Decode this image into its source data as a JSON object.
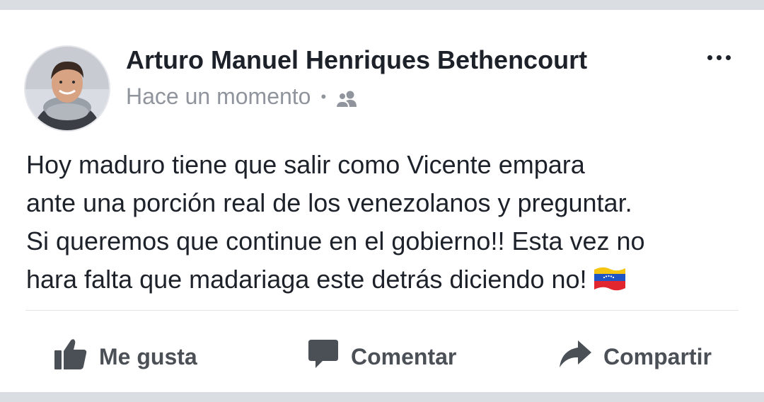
{
  "post": {
    "author": "Arturo Manuel Henriques Bethencourt",
    "timestamp": "Hace un momento",
    "separator": "•",
    "audience_icon": "friends-icon",
    "text": "Hoy maduro tiene que salir como Vicente empara\nante una porción real de los venezolanos y preguntar.\nSi queremos que continue en el gobierno!! Esta vez no\nhara falta que madariaga este detrás diciendo no!",
    "emoji": "venezuela-flag"
  },
  "actions": {
    "like_label": "Me gusta",
    "comment_label": "Comentar",
    "share_label": "Compartir"
  },
  "colors": {
    "text": "#1d2129",
    "meta": "#90949c",
    "action": "#4b4f56",
    "background": "#dadde1"
  }
}
